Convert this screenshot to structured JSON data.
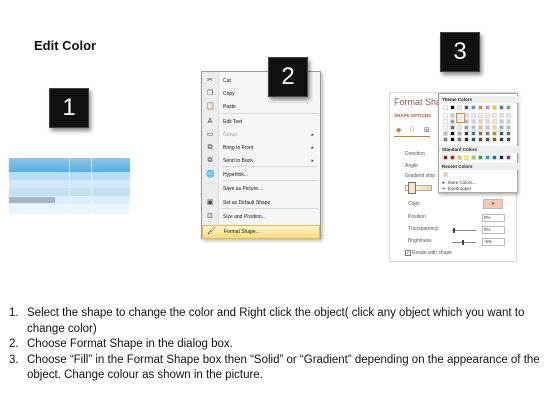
{
  "title": "Edit Color",
  "badges": [
    "1",
    "2",
    "3"
  ],
  "context_menu": {
    "items": [
      {
        "icon": "cut-icon",
        "glyph": "✂",
        "label": "Cut",
        "submenu": false,
        "disabled": false
      },
      {
        "icon": "copy-icon",
        "glyph": "❐",
        "label": "Copy",
        "submenu": false,
        "disabled": false
      },
      {
        "icon": "paste-icon",
        "glyph": "📋",
        "label": "Paste",
        "submenu": false,
        "disabled": false
      },
      {
        "icon": "edit-text-icon",
        "glyph": "A",
        "label": "Edit Text",
        "submenu": false,
        "disabled": false
      },
      {
        "icon": "group-icon",
        "glyph": "▭",
        "label": "Group",
        "submenu": true,
        "disabled": true
      },
      {
        "icon": "bring-to-front-icon",
        "glyph": "⧉",
        "label": "Bring to Front",
        "submenu": true,
        "disabled": false
      },
      {
        "icon": "send-to-back-icon",
        "glyph": "⧉",
        "label": "Send to Back",
        "submenu": true,
        "disabled": false
      },
      {
        "icon": "hyperlink-icon",
        "glyph": "🌐",
        "label": "Hyperlink...",
        "submenu": false,
        "disabled": false
      },
      {
        "icon": "",
        "glyph": "",
        "label": "Save as Picture...",
        "submenu": false,
        "disabled": false
      },
      {
        "icon": "set-default-icon",
        "glyph": "▣",
        "label": "Set as Default Shape",
        "submenu": false,
        "disabled": false
      },
      {
        "icon": "size-position-icon",
        "glyph": "⊡",
        "label": "Size and Position...",
        "submenu": false,
        "disabled": false
      },
      {
        "icon": "format-shape-icon",
        "glyph": "🖌",
        "label": "Format Shape...",
        "submenu": false,
        "disabled": false,
        "highlighted": true
      }
    ]
  },
  "format_shape": {
    "title": "Format Sha",
    "tab": "SHAPE OPTIONS",
    "labels": {
      "direction": "Direction",
      "angle": "Angle",
      "gradient_stops": "Gradient stop",
      "color": "Color",
      "position": "Position",
      "transparency": "Transparency",
      "brightness": "Brightness",
      "rotate": "Rotate with shape"
    },
    "values": {
      "position": "0%",
      "transparency": "0%",
      "brightness": "-5%"
    }
  },
  "palette": {
    "theme_label": "Theme Colors",
    "standard_label": "Standard Colors",
    "recent_label": "Recent Colors",
    "more_colors": "More Colors...",
    "eyedropper": "Eyedropper",
    "theme_top": [
      "#ffffff",
      "#000000",
      "#e7e6e6",
      "#44546a",
      "#5b9bd5",
      "#ed7d31",
      "#a5a5a5",
      "#ffc000",
      "#4472c4",
      "#70ad47"
    ],
    "standard": [
      "#c00000",
      "#ff0000",
      "#ffc000",
      "#ffff00",
      "#92d050",
      "#00b050",
      "#00b0f0",
      "#0070c0",
      "#002060",
      "#7030a0"
    ]
  },
  "instructions": [
    {
      "num": "1.",
      "text": "Select the shape to change the color and Right click the object( click any object which you want to change color)"
    },
    {
      "num": "2.",
      "text": "Choose Format Shape in the dialog box."
    },
    {
      "num": "3.",
      "text": "Choose “Fill” in the Format Shape box then “Solid” or “Gradient” depending on the appearance of the object. Change colour as shown in the picture."
    }
  ]
}
